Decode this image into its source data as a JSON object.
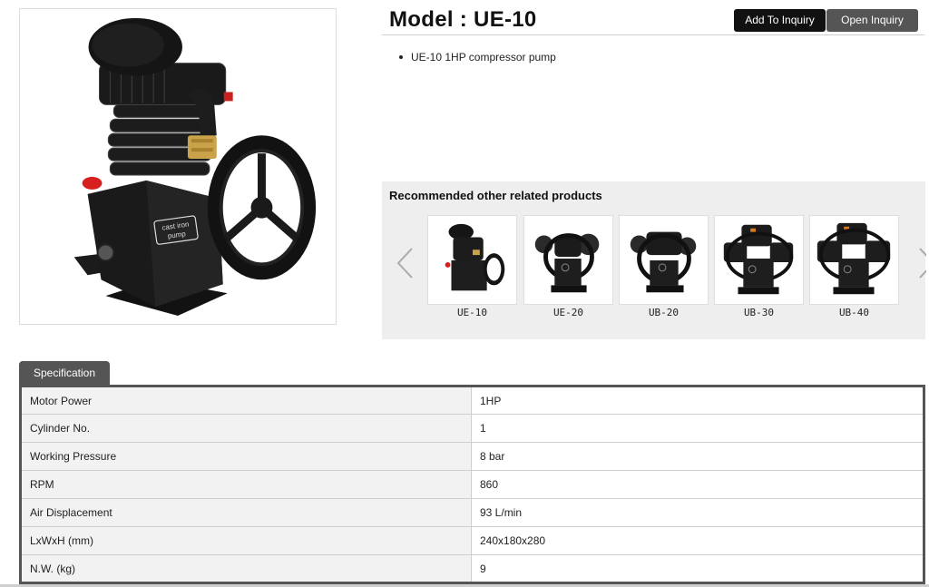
{
  "product": {
    "title": "Model : UE-10",
    "description_items": [
      "UE-10 1HP compressor pump"
    ],
    "image_badge_line1": "cast iron",
    "image_badge_line2": "pump"
  },
  "actions": {
    "add_label": "Add To Inquiry",
    "open_label": "Open Inquiry"
  },
  "recommended": {
    "heading": "Recommended other related products",
    "items": [
      {
        "label": "UE-10",
        "icon": "compressor-pump-icon"
      },
      {
        "label": "UE-20",
        "icon": "compressor-pump-icon"
      },
      {
        "label": "UB-20",
        "icon": "compressor-pump-icon"
      },
      {
        "label": "UB-30",
        "icon": "compressor-pump-icon"
      },
      {
        "label": "UB-40",
        "icon": "compressor-pump-icon"
      }
    ]
  },
  "spec": {
    "tab_label": "Specification",
    "rows": [
      {
        "key": "Motor Power",
        "value": "1HP"
      },
      {
        "key": "Cylinder No.",
        "value": "1"
      },
      {
        "key": "Working Pressure",
        "value": "8 bar"
      },
      {
        "key": "RPM",
        "value": "860"
      },
      {
        "key": "Air Displacement",
        "value": "93 L/min"
      },
      {
        "key": "LxWxH (mm)",
        "value": "240x180x280"
      },
      {
        "key": "N.W. (kg)",
        "value": "9"
      }
    ]
  },
  "colors": {
    "black_button": "#111111",
    "grey_button": "#555555",
    "panel_bg": "#eeeeee",
    "accent_red": "#d81f1f",
    "brass": "#c9a24a"
  }
}
